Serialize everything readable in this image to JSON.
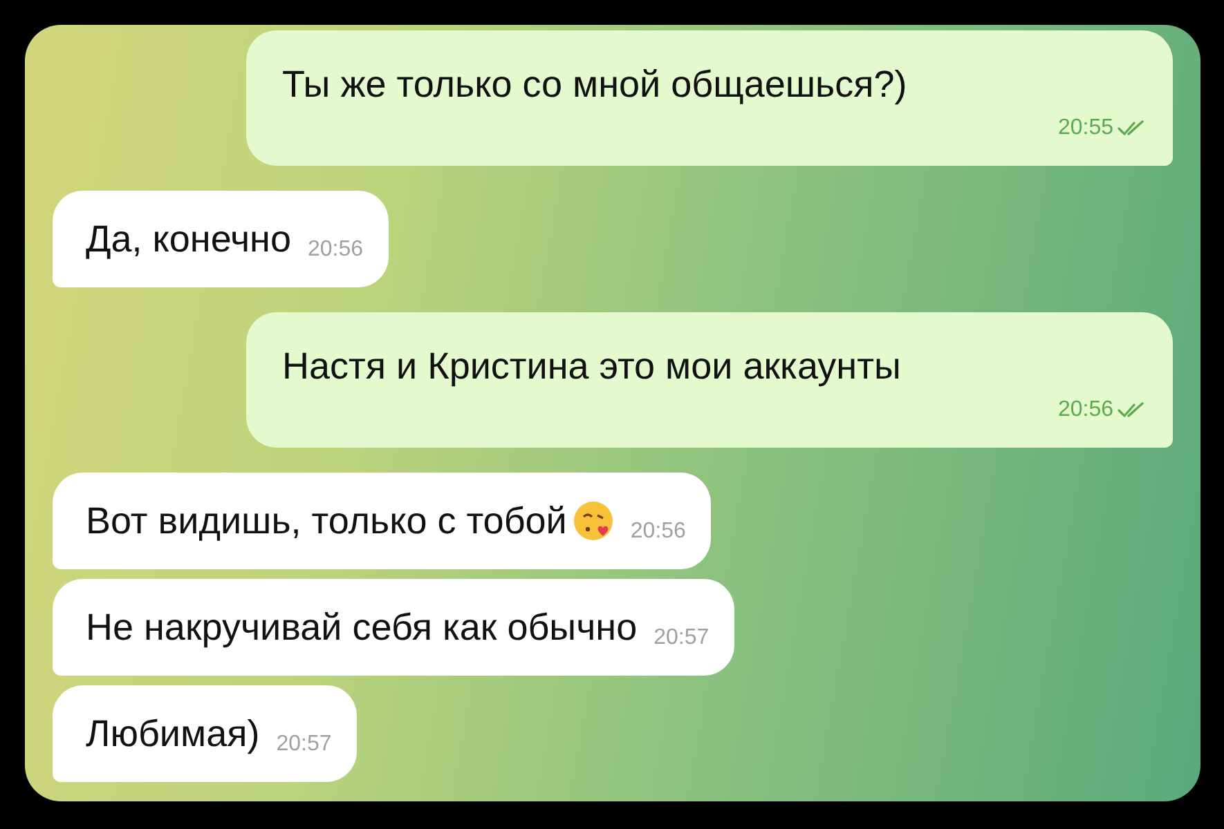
{
  "messages": [
    {
      "kind": "outgoing",
      "text": "Ты же только со мной общаешься?)",
      "time": "20:55",
      "read": true
    },
    {
      "kind": "incoming",
      "text": "Да, конечно",
      "time": "20:56"
    },
    {
      "kind": "outgoing",
      "text": "Настя и Кристина это мои аккаунты",
      "time": "20:56",
      "read": true
    },
    {
      "kind": "incoming",
      "text": "Вот видишь, только с тобой",
      "attachment": {
        "kind": "kiss-emoji"
      },
      "time": "20:56"
    },
    {
      "kind": "incoming",
      "text": "Не накручивай себя как обычно",
      "time": "20:57"
    },
    {
      "kind": "incoming",
      "text": "Любимая)",
      "time": "20:57"
    }
  ]
}
